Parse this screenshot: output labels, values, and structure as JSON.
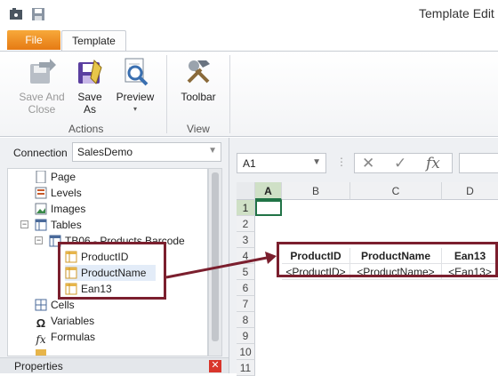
{
  "window": {
    "title": "Template Edit"
  },
  "ribbon": {
    "tabs": [
      "File",
      "Template"
    ],
    "buttons": {
      "save_and_close": "Save And Close",
      "save_as": "Save As",
      "preview": "Preview",
      "toolbar": "Toolbar"
    },
    "groups": {
      "actions": "Actions",
      "view": "View"
    }
  },
  "connection": {
    "label": "Connection",
    "value": "SalesDemo"
  },
  "tree": {
    "items": [
      "Page",
      "Levels",
      "Images",
      "Tables",
      "TB06 - Products Barcode",
      "ProductID",
      "ProductName",
      "Ean13",
      "Cells",
      "Variables",
      "Formulas"
    ]
  },
  "properties": {
    "title": "Properties"
  },
  "sheet": {
    "name_box": "A1",
    "columns": [
      "A",
      "B",
      "C",
      "D"
    ],
    "rows": [
      "1",
      "2",
      "3",
      "4",
      "5",
      "6",
      "7",
      "8",
      "9",
      "10",
      "11"
    ],
    "headers": [
      "ProductID",
      "ProductName",
      "Ean13"
    ],
    "placeholders": [
      "<ProductID>",
      "<ProductName>",
      "<Ean13>"
    ]
  },
  "colors": {
    "accent_file_tab": "#e67a13",
    "highlight_box": "#7b1f2e",
    "selection_green": "#217346"
  }
}
